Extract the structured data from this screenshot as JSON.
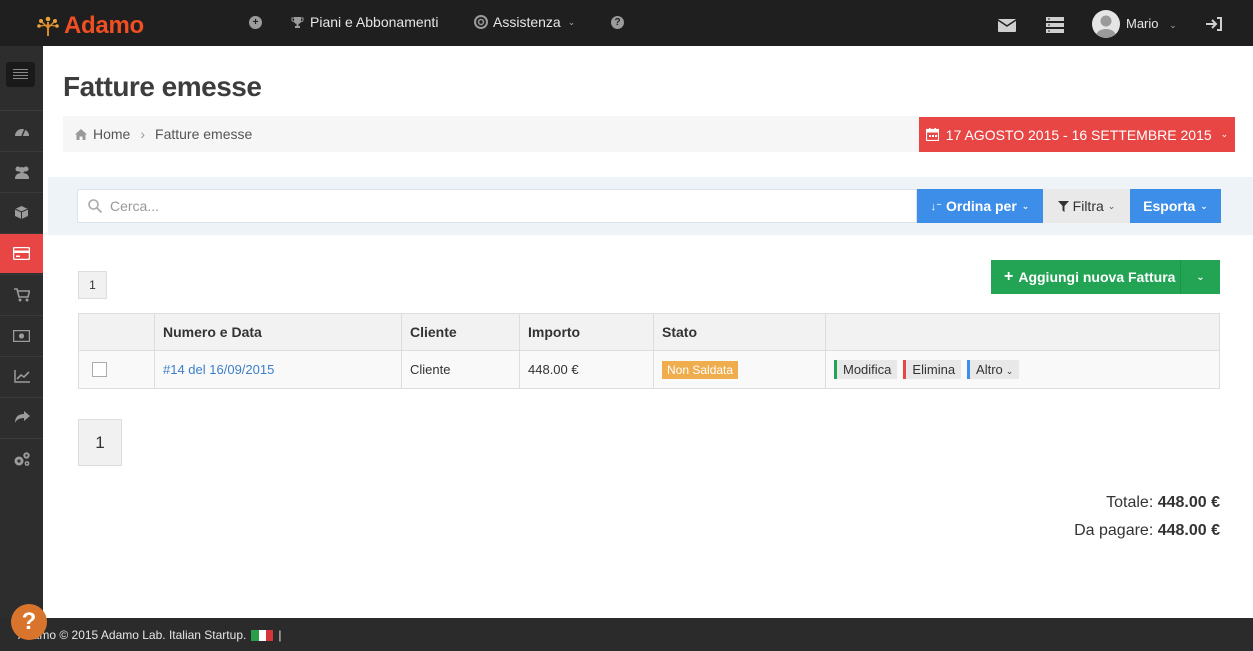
{
  "app": {
    "name": "Adamo"
  },
  "topnav": {
    "plans_label": "Piani e Abbonamenti",
    "support_label": "Assistenza",
    "user_name": "Mario"
  },
  "page": {
    "title": "Fatture emesse",
    "breadcrumb": {
      "home": "Home",
      "current": "Fatture emesse"
    },
    "date_range": "17 AGOSTO 2015 - 16 SETTEMBRE 2015"
  },
  "toolbar": {
    "search_placeholder": "Cerca...",
    "order_label": "Ordina per",
    "filter_label": "Filtra",
    "export_label": "Esporta",
    "add_label": "Aggiungi nuova Fattura"
  },
  "pagination": {
    "top_page": "1",
    "bottom_page": "1"
  },
  "table": {
    "headers": [
      "Numero e Data",
      "Cliente",
      "Importo",
      "Stato"
    ],
    "rows": [
      {
        "number_date": "#14 del 16/09/2015",
        "client": "Cliente",
        "amount": "448.00 €",
        "status": "Non Saldata",
        "actions": {
          "edit": "Modifica",
          "delete": "Elimina",
          "more": "Altro"
        }
      }
    ]
  },
  "totals": {
    "total_label": "Totale:",
    "total_value": "448.00 €",
    "due_label": "Da pagare:",
    "due_value": "448.00 €"
  },
  "footer": {
    "text": "Adamo © 2015 Adamo Lab. Italian Startup.",
    "separator": "|"
  },
  "help": {
    "label": "?"
  },
  "colors": {
    "brand": "#f04e23",
    "active_red": "#e84545",
    "primary_blue": "#3d8ee8",
    "success_green": "#23a455",
    "warning": "#f0ad4e"
  },
  "icons": {
    "sidebar": [
      "dashboard-icon",
      "users-icon",
      "box-icon",
      "credit-card-icon",
      "cart-icon",
      "money-icon",
      "chart-line-icon",
      "share-icon",
      "gears-icon"
    ]
  }
}
